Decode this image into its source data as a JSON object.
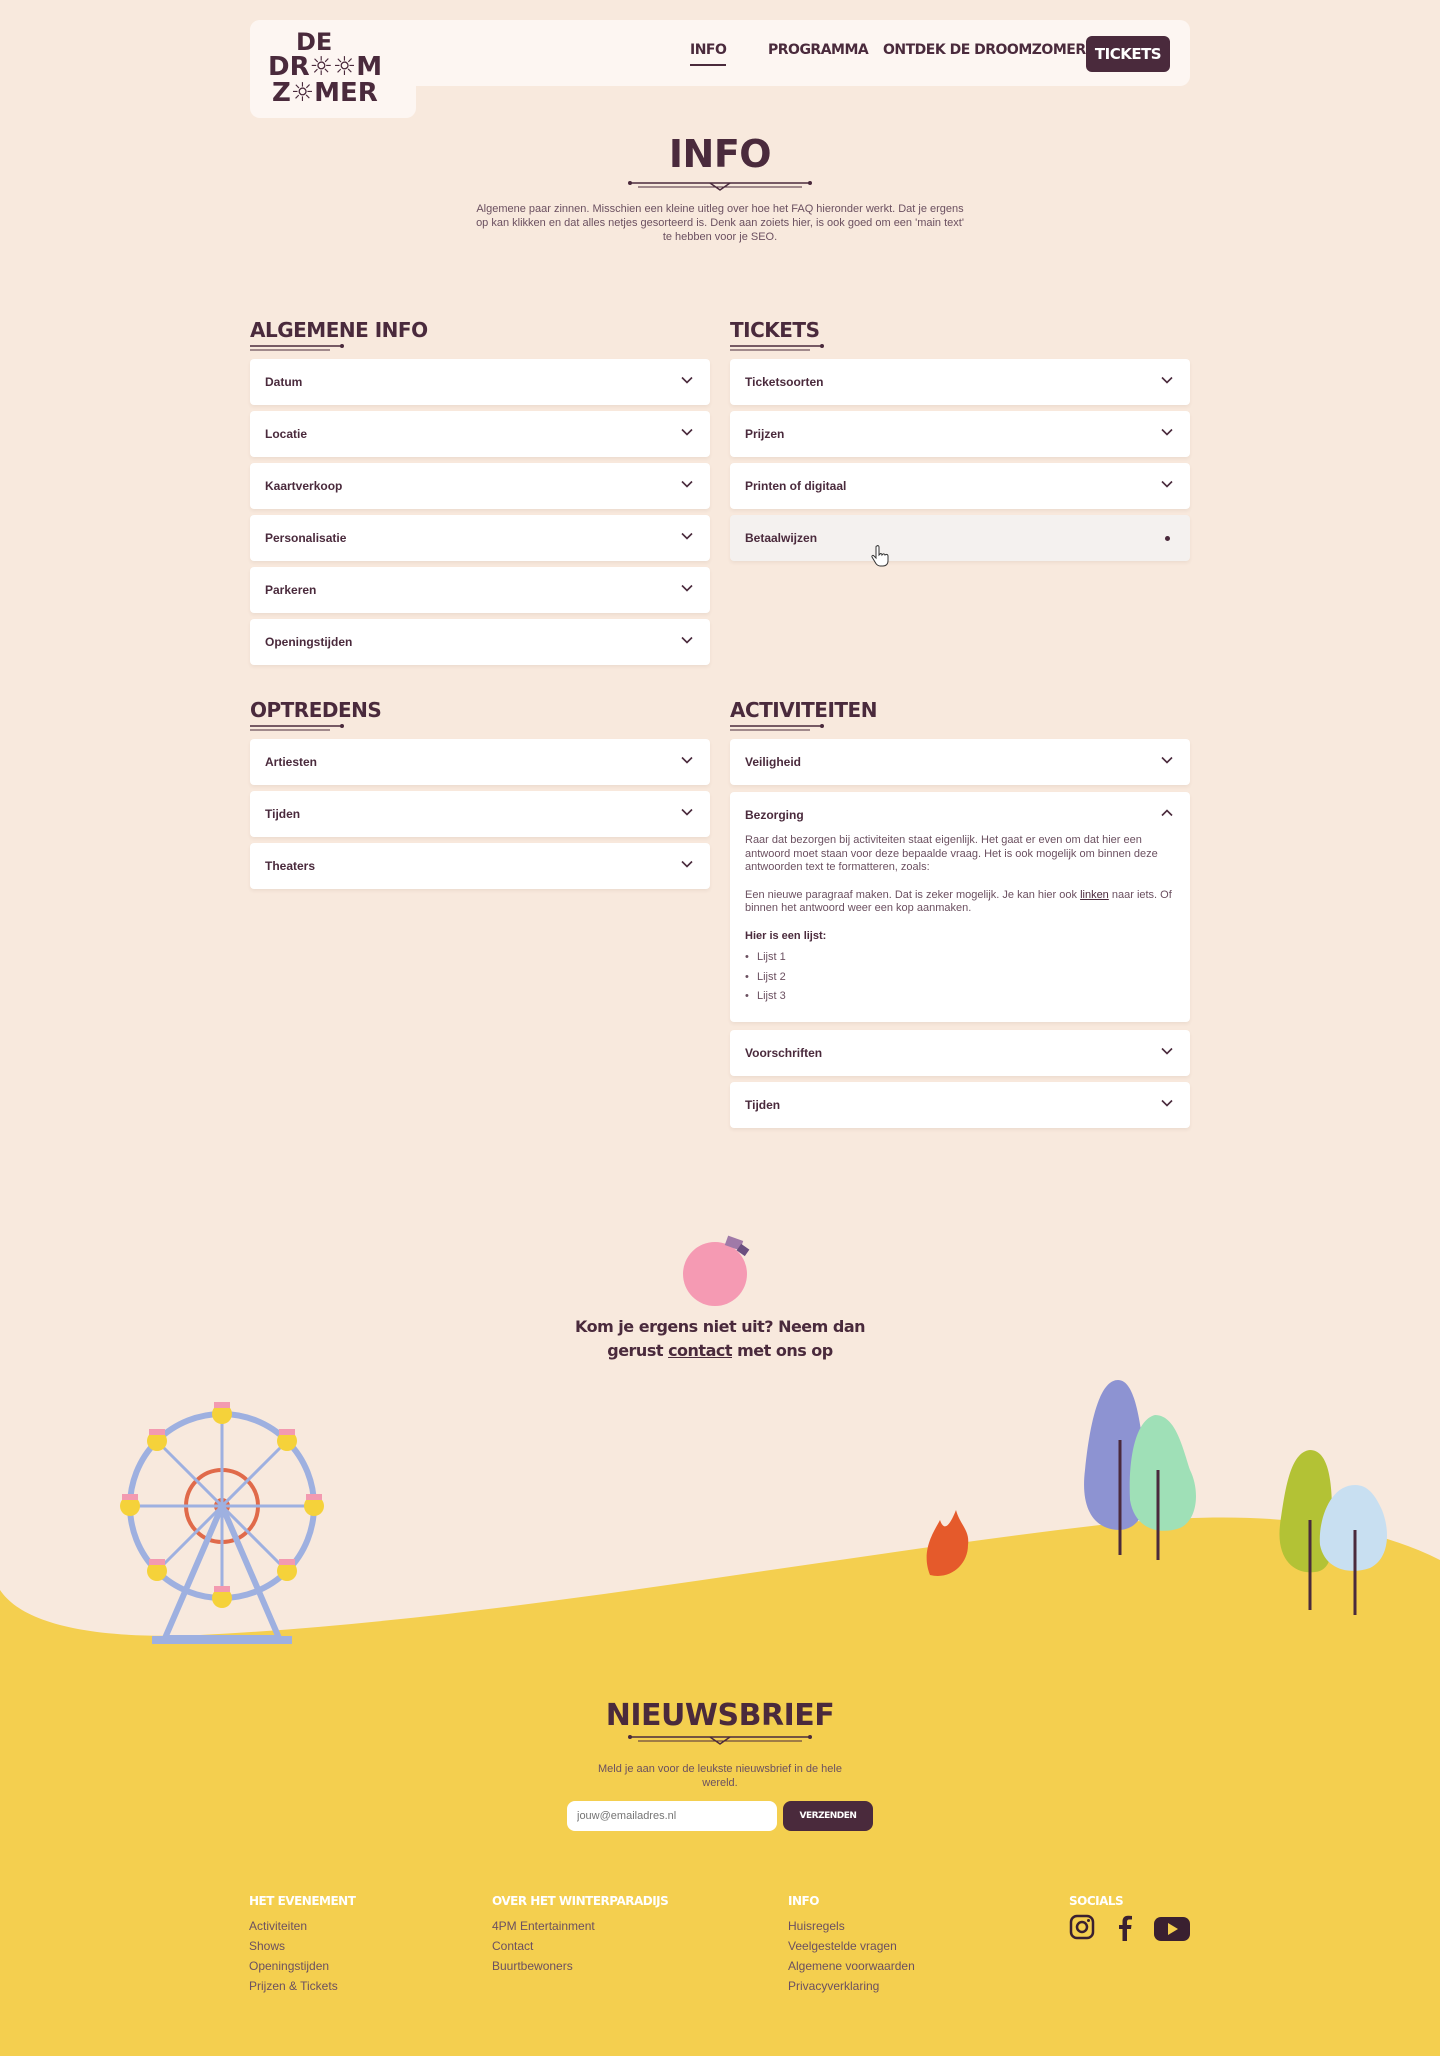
{
  "header": {
    "logo": {
      "line1": "DE",
      "line2": "DROOMZ",
      "line2_display": "DR☼☼M",
      "line3": "Z☼MER"
    },
    "nav": [
      {
        "label": "INFO",
        "active": true
      },
      {
        "label": "PROGRAMMA",
        "active": false
      },
      {
        "label": "ONTDEK DE DROOMZOMER",
        "active": false,
        "has_dropdown": true
      }
    ],
    "cta": "TICKETS"
  },
  "hero": {
    "title": "INFO",
    "intro": "Algemene paar zinnen. Misschien een kleine uitleg over hoe het FAQ hieronder werkt. Dat je ergens op kan klikken en dat alles netjes gesorteerd is. Denk aan zoiets hier, is ook goed om een 'main text' te hebben voor je SEO."
  },
  "faq": {
    "algemene": {
      "title": "ALGEMENE INFO",
      "items": [
        "Datum",
        "Locatie",
        "Kaartverkoop",
        "Personalisatie",
        "Parkeren",
        "Openingstijden"
      ]
    },
    "tickets": {
      "title": "TICKETS",
      "items": [
        "Ticketsoorten",
        "Prijzen",
        "Printen of digitaal",
        "Betaalwijzen"
      ]
    },
    "optredens": {
      "title": "OPTREDENS",
      "items": [
        "Artiesten",
        "Tijden",
        "Theaters"
      ]
    },
    "activiteiten": {
      "title": "ACTIVITEITEN",
      "items": [
        "Veiligheid",
        "Bezorging",
        "Voorschriften",
        "Tijden"
      ],
      "open_answer": {
        "p1": "Raar dat bezorgen bij activiteiten staat eigenlijk. Het gaat er even om dat hier een antwoord moet staan voor deze bepaalde vraag. Het is ook mogelijk om binnen deze antwoorden text te formatteren, zoals:",
        "p2_before": "Een nieuwe paragraaf maken. Dat is zeker mogelijk. Je kan hier ook ",
        "p2_link": "linken",
        "p2_after": " naar iets. Of binnen het antwoord weer een kop aanmaken.",
        "heading": "Hier is een lijst:",
        "list": [
          "Lijst 1",
          "Lijst 2",
          "Lijst 3"
        ]
      }
    }
  },
  "contact": {
    "before": "Kom je ergens niet uit? Neem dan gerust ",
    "link": "contact",
    "after": " met ons op"
  },
  "newsletter": {
    "title": "NIEUWSBRIEF",
    "text": "Meld je aan voor de leukste nieuwsbrief in de hele wereld.",
    "placeholder": "jouw@emailadres.nl",
    "button": "VERZENDEN"
  },
  "footer": {
    "columns": [
      {
        "title": "HET EVENEMENT",
        "links": [
          "Activiteiten",
          "Shows",
          "Openingstijden",
          "Prijzen & Tickets"
        ]
      },
      {
        "title": "OVER HET WINTERPARADIJS",
        "links": [
          "4PM Entertainment",
          "Contact",
          "Buurtbewoners"
        ]
      },
      {
        "title": "INFO",
        "links": [
          "Huisregels",
          "Veelgestelde vragen",
          "Algemene voorwaarden",
          "Privacyverklaring"
        ]
      }
    ],
    "socials_title": "SOCIALS",
    "socials": [
      "instagram-icon",
      "facebook-icon",
      "youtube-icon"
    ]
  },
  "colors": {
    "bg": "#f8e9dd",
    "plum": "#4a2a3c",
    "yellow": "#f4cf4f",
    "card": "#ffffff"
  }
}
